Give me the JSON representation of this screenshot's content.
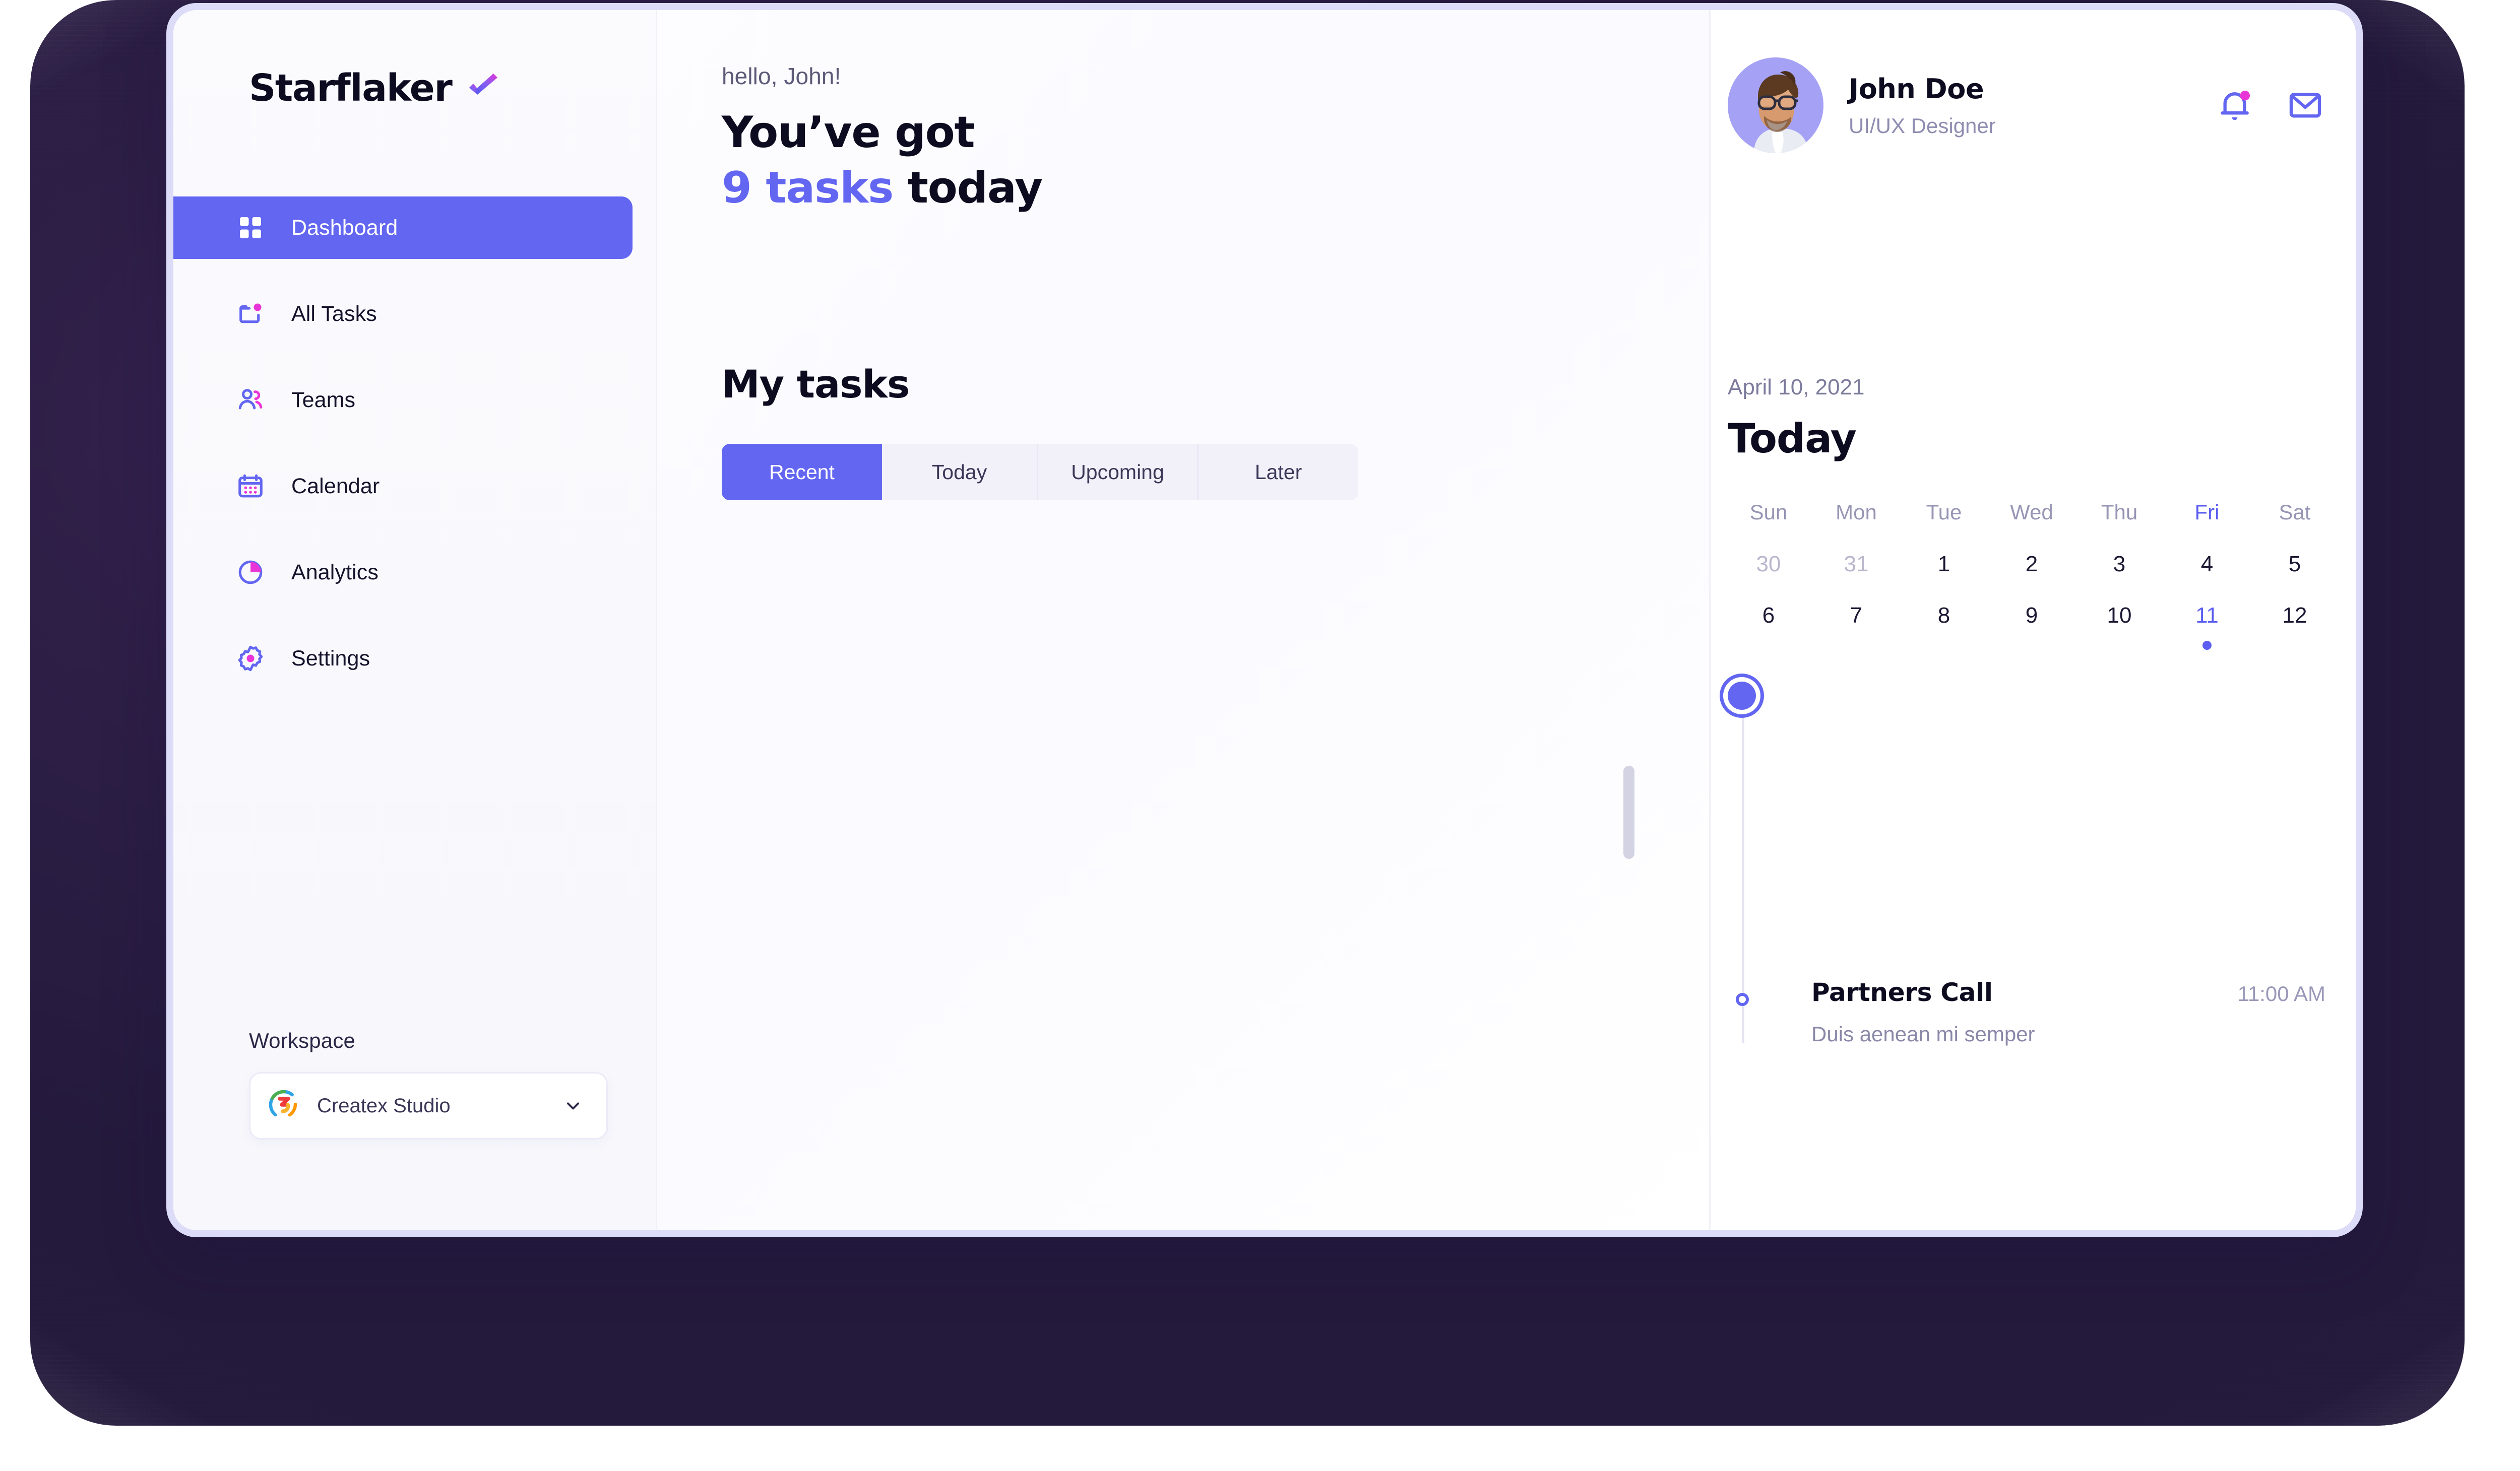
{
  "brand": {
    "name": "Starflaker",
    "check_icon": "gradient-check-icon",
    "accent": "#6366f1",
    "accent_pink": "#e935d8"
  },
  "sidebar": {
    "items": [
      {
        "label": "Dashboard",
        "icon": "grid-icon",
        "active": true
      },
      {
        "label": "All Tasks",
        "icon": "tasks-folder-icon",
        "active": false
      },
      {
        "label": "Teams",
        "icon": "users-icon",
        "active": false
      },
      {
        "label": "Calendar",
        "icon": "calendar-icon",
        "active": false
      },
      {
        "label": "Analytics",
        "icon": "pie-chart-icon",
        "active": false
      },
      {
        "label": "Settings",
        "icon": "gear-icon",
        "active": false
      }
    ],
    "workspace": {
      "label": "Workspace",
      "selected": "Createx Studio",
      "logo_icon": "createx-logo-icon",
      "chevron_icon": "chevron-down-icon"
    }
  },
  "main": {
    "greeting": "hello, John!",
    "headline_line1": "You’ve got",
    "headline_count": "9 tasks",
    "headline_suffix": " today",
    "tasks_title": "My tasks",
    "tabs": [
      {
        "label": "Recent",
        "active": true
      },
      {
        "label": "Today",
        "active": false
      },
      {
        "label": "Upcoming",
        "active": false
      },
      {
        "label": "Later",
        "active": false
      }
    ]
  },
  "profile": {
    "name": "John Doe",
    "role": "UI/UX Designer",
    "avatar_icon": "user-avatar-photo",
    "notifications_icon": "bell-icon",
    "notifications_badge": true,
    "messages_icon": "envelope-icon"
  },
  "calendar": {
    "date_label": "April 10, 2021",
    "heading": "Today",
    "weekdays": [
      {
        "label": "Sun",
        "highlight": false
      },
      {
        "label": "Mon",
        "highlight": false
      },
      {
        "label": "Tue",
        "highlight": false
      },
      {
        "label": "Wed",
        "highlight": false
      },
      {
        "label": "Thu",
        "highlight": false
      },
      {
        "label": "Fri",
        "highlight": true
      },
      {
        "label": "Sat",
        "highlight": false
      }
    ],
    "days": [
      {
        "label": "30",
        "muted": true,
        "selected": false,
        "dot": false
      },
      {
        "label": "31",
        "muted": true,
        "selected": false,
        "dot": false
      },
      {
        "label": "1",
        "muted": false,
        "selected": false,
        "dot": false
      },
      {
        "label": "2",
        "muted": false,
        "selected": false,
        "dot": false
      },
      {
        "label": "3",
        "muted": false,
        "selected": false,
        "dot": false
      },
      {
        "label": "4",
        "muted": false,
        "selected": false,
        "dot": false
      },
      {
        "label": "5",
        "muted": false,
        "selected": false,
        "dot": false
      },
      {
        "label": "6",
        "muted": false,
        "selected": false,
        "dot": false
      },
      {
        "label": "7",
        "muted": false,
        "selected": false,
        "dot": false
      },
      {
        "label": "8",
        "muted": false,
        "selected": false,
        "dot": false
      },
      {
        "label": "9",
        "muted": false,
        "selected": false,
        "dot": false
      },
      {
        "label": "10",
        "muted": false,
        "selected": false,
        "dot": false
      },
      {
        "label": "11",
        "muted": false,
        "selected": true,
        "dot": true
      },
      {
        "label": "12",
        "muted": false,
        "selected": false,
        "dot": false
      }
    ]
  },
  "timeline": {
    "events": [
      {
        "title": "Partners Call",
        "time": "11:00 AM",
        "subtitle": "Duis aenean mi semper"
      }
    ]
  }
}
